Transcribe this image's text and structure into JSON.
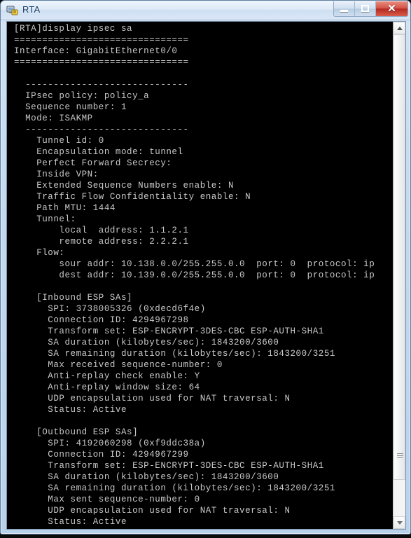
{
  "window": {
    "title": "RTA",
    "icon": "network-app-icon",
    "controls": {
      "minimize_label": "–",
      "maximize_label": "□",
      "close_label": "✕"
    }
  },
  "scrollbar": {
    "up_arrow": "scroll-up-arrow-icon",
    "down_arrow": "scroll-down-arrow-icon"
  },
  "terminal": {
    "lines": [
      "[RTA]display ipsec sa",
      "===============================",
      "Interface: GigabitEthernet0/0",
      "===============================",
      "",
      "  -----------------------------",
      "  IPsec policy: policy_a",
      "  Sequence number: 1",
      "  Mode: ISAKMP",
      "  -----------------------------",
      "    Tunnel id: 0",
      "    Encapsulation mode: tunnel",
      "    Perfect Forward Secrecy:",
      "    Inside VPN:",
      "    Extended Sequence Numbers enable: N",
      "    Traffic Flow Confidentiality enable: N",
      "    Path MTU: 1444",
      "    Tunnel:",
      "        local  address: 1.1.2.1",
      "        remote address: 2.2.2.1",
      "    Flow:",
      "        sour addr: 10.138.0.0/255.255.0.0  port: 0  protocol: ip",
      "        dest addr: 10.139.0.0/255.255.0.0  port: 0  protocol: ip",
      "",
      "    [Inbound ESP SAs]",
      "      SPI: 3738005326 (0xdecd6f4e)",
      "      Connection ID: 4294967298",
      "      Transform set: ESP-ENCRYPT-3DES-CBC ESP-AUTH-SHA1",
      "      SA duration (kilobytes/sec): 1843200/3600",
      "      SA remaining duration (kilobytes/sec): 1843200/3251",
      "      Max received sequence-number: 0",
      "      Anti-replay check enable: Y",
      "      Anti-replay window size: 64",
      "      UDP encapsulation used for NAT traversal: N",
      "      Status: Active",
      "",
      "    [Outbound ESP SAs]",
      "      SPI: 4192060298 (0xf9ddc38a)",
      "      Connection ID: 4294967299",
      "      Transform set: ESP-ENCRYPT-3DES-CBC ESP-AUTH-SHA1",
      "      SA duration (kilobytes/sec): 1843200/3600",
      "      SA remaining duration (kilobytes/sec): 1843200/3251",
      "      Max sent sequence-number: 0",
      "      UDP encapsulation used for NAT traversal: N",
      "      Status: Active"
    ]
  }
}
